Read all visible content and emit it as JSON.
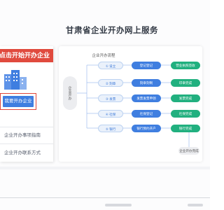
{
  "header": {
    "title": "甘肃省企业开办网上服务"
  },
  "left_panel": {
    "start_banner": "点击开始开办企业",
    "apply_button": "我要开办企业",
    "links": [
      "企业开办事项指南",
      "企业开办联系方式"
    ]
  },
  "flow": {
    "title": "企业开办流程",
    "side_label": "企业开办",
    "steps": [
      {
        "step": "① 设立",
        "mid": "登记登记",
        "done": "营业执照签收"
      },
      {
        "step": "② 刻章",
        "mid": "刻章刻制",
        "done": "印章完成"
      },
      {
        "step": "③ 发票",
        "mid": "发票发票申领",
        "done": "发票完成"
      },
      {
        "step": "④ 社保",
        "mid": "社保登记",
        "done": "社保完成"
      },
      {
        "step": "⑤ 银行",
        "mid": "银行预约开户",
        "done": "银行完成"
      }
    ],
    "final": "企业开办完成"
  },
  "colors": {
    "accent_red": "#e04a3e",
    "accent_blue": "#3f7ee0",
    "accent_green": "#21b07f"
  }
}
